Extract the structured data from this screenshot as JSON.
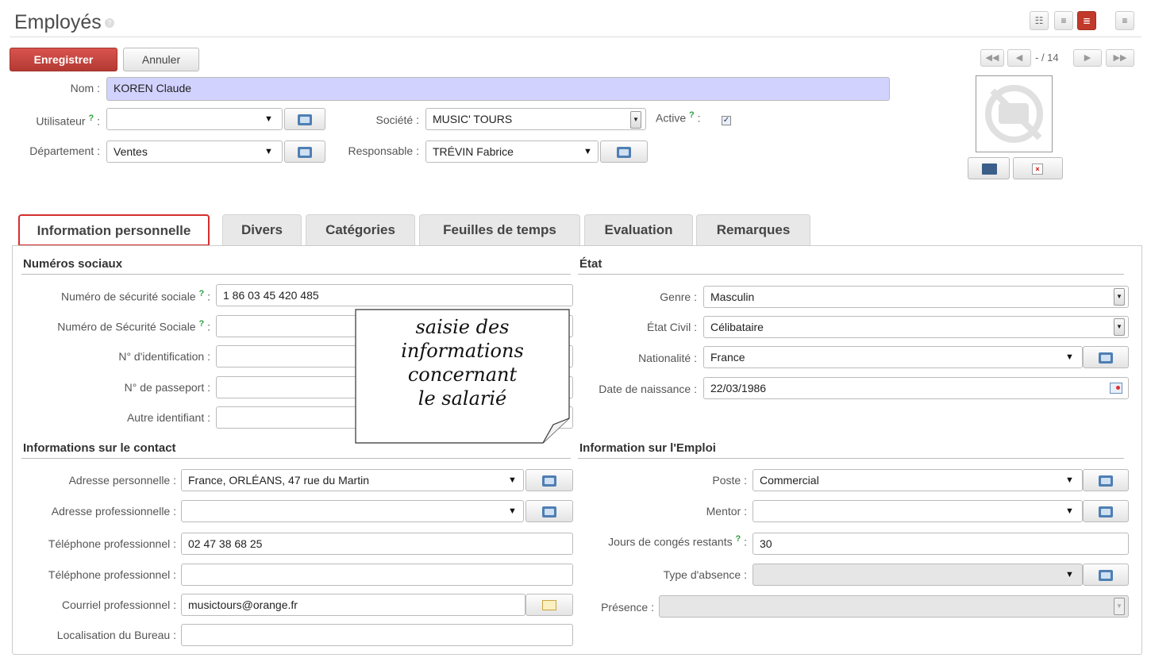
{
  "header": {
    "title": "Employés",
    "help": "?"
  },
  "view_switcher": [
    "kanban-view-icon",
    "list-view-icon",
    "form-view-icon",
    "calendar-view-icon"
  ],
  "toolbar": {
    "save_label": "Enregistrer",
    "cancel_label": "Annuler"
  },
  "pager": {
    "counter": "- / 14"
  },
  "form": {
    "name_label": "Nom :",
    "name_value": "KOREN Claude",
    "user_label": "Utilisateur",
    "user_value": "",
    "company_label": "Société :",
    "company_value": "MUSIC' TOURS",
    "active_label": "Active",
    "active_checked": true,
    "department_label": "Département :",
    "department_value": "Ventes",
    "manager_label": "Responsable :",
    "manager_value": "TRÉVIN Fabrice",
    "help_mark": "?",
    "colon": ":"
  },
  "tabs": [
    {
      "label": "Information personnelle",
      "active": true
    },
    {
      "label": "Divers"
    },
    {
      "label": "Catégories"
    },
    {
      "label": "Feuilles de temps"
    },
    {
      "label": "Evaluation"
    },
    {
      "label": "Remarques"
    }
  ],
  "social": {
    "title": "Numéros sociaux",
    "fields": [
      {
        "label": "Numéro de sécurité sociale",
        "help": true,
        "value": "1 86 03 45 420 485"
      },
      {
        "label": "Numéro de Sécurité Sociale",
        "help": true,
        "value": ""
      },
      {
        "label": "N° d'identification :",
        "value": ""
      },
      {
        "label": "N° de passeport :",
        "value": ""
      },
      {
        "label": "Autre identifiant :",
        "value": ""
      }
    ]
  },
  "status": {
    "title": "État",
    "gender_label": "Genre :",
    "gender_value": "Masculin",
    "marital_label": "État Civil :",
    "marital_value": "Célibataire",
    "nationality_label": "Nationalité :",
    "nationality_value": "France",
    "birth_label": "Date de naissance :",
    "birth_value": "22/03/1986"
  },
  "contact": {
    "title": "Informations sur le contact",
    "home_address_label": "Adresse personnelle :",
    "home_address_value": "France, ORLÉANS, 47 rue du Martin",
    "work_address_label": "Adresse professionnelle :",
    "work_address_value": "",
    "work_phone_label": "Téléphone professionnel :",
    "work_phone_value": "02 47 38 68 25",
    "mobile_phone_label": "Téléphone professionnel :",
    "mobile_phone_value": "",
    "email_label": "Courriel professionnel :",
    "email_value": "musictours@orange.fr",
    "office_label": "Localisation du Bureau :",
    "office_value": ""
  },
  "job": {
    "title": "Information sur l'Emploi",
    "position_label": "Poste :",
    "position_value": "Commercial",
    "mentor_label": "Mentor :",
    "mentor_value": "",
    "leaves_label": "Jours de congés restants",
    "leaves_value": "30",
    "leave_type_label": "Type d'absence :",
    "leave_type_value": "",
    "presence_label": "Présence :",
    "presence_value": ""
  },
  "callout": {
    "lines": [
      "saisie des",
      "informations",
      "concernant",
      "le salarié"
    ]
  }
}
